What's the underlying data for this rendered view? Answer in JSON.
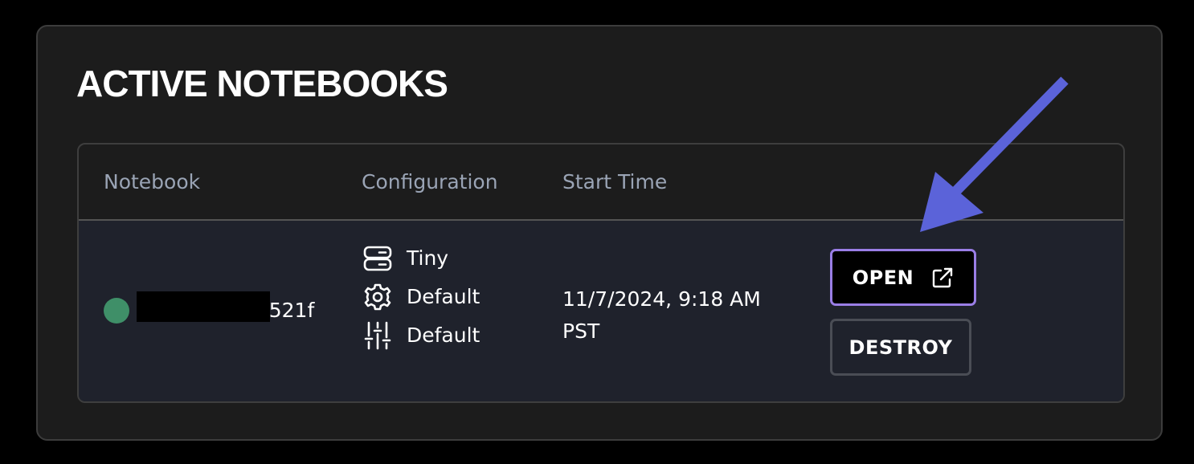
{
  "panel": {
    "title": "ACTIVE NOTEBOOKS"
  },
  "table": {
    "columns": [
      "Notebook",
      "Configuration",
      "Start Time"
    ],
    "rows": [
      {
        "status_color": "#3f8f68",
        "notebook_name_visible": "521f",
        "config": [
          {
            "icon": "server-icon",
            "label": "Tiny"
          },
          {
            "icon": "gear-icon",
            "label": "Default"
          },
          {
            "icon": "sliders-icon",
            "label": "Default"
          }
        ],
        "start_time": "11/7/2024, 9:18 AM PST",
        "actions": {
          "open_label": "OPEN",
          "destroy_label": "DESTROY"
        }
      }
    ]
  },
  "annotation": {
    "arrow_color": "#5b63d9"
  },
  "colors": {
    "panel_bg": "#1c1c1c",
    "row_bg": "#1f222c",
    "header_text": "#9aa4b5",
    "open_border": "#9a7ee6",
    "destroy_border": "#4a4d55"
  }
}
